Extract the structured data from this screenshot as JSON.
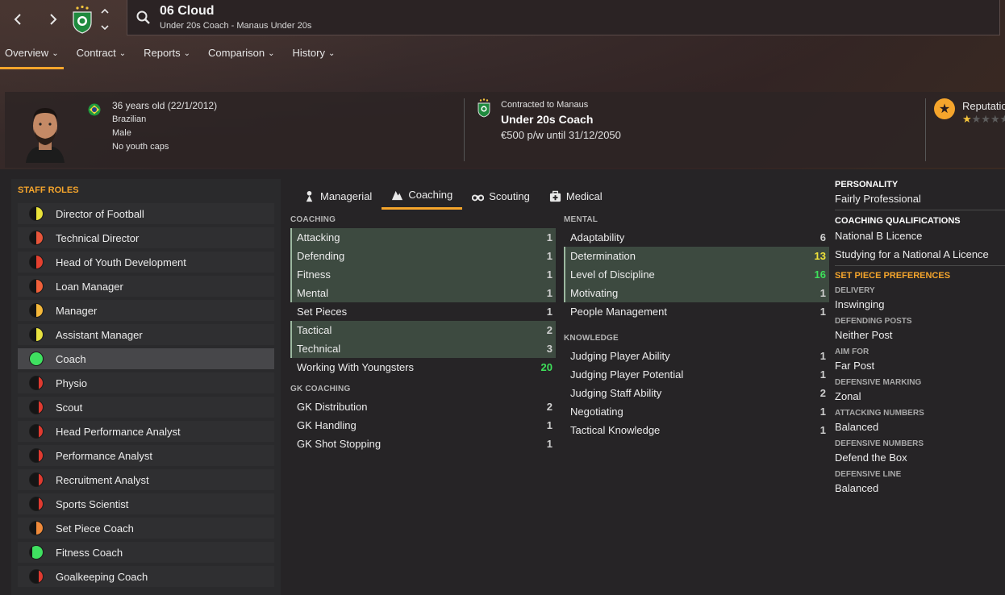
{
  "header": {
    "name": "06 Cloud",
    "subtitle": "Under 20s Coach - Manaus Under 20s"
  },
  "tabs": [
    {
      "label": "Overview"
    },
    {
      "label": "Contract"
    },
    {
      "label": "Reports"
    },
    {
      "label": "Comparison"
    },
    {
      "label": "History"
    }
  ],
  "profile": {
    "age": "36 years old (22/1/2012)",
    "nationality": "Brazilian",
    "gender": "Male",
    "youth_caps": "No youth caps",
    "contract_label": "Contracted to Manaus",
    "role": "Under 20s Coach",
    "wage": "€500 p/w until 31/12/2050",
    "reputation_label": "Reputation",
    "reputation_stars": 1
  },
  "staff_roles": {
    "title": "STAFF ROLES",
    "items": [
      {
        "label": "Director of Football",
        "color": "#e9e23a",
        "fill": 0.5
      },
      {
        "label": "Technical Director",
        "color": "#e8553a",
        "fill": 0.5
      },
      {
        "label": "Head of Youth Development",
        "color": "#e5402f",
        "fill": 0.5
      },
      {
        "label": "Loan Manager",
        "color": "#f0603a",
        "fill": 0.5
      },
      {
        "label": "Manager",
        "color": "#f5b83a",
        "fill": 0.5
      },
      {
        "label": "Assistant Manager",
        "color": "#e8e240",
        "fill": 0.5
      },
      {
        "label": "Coach",
        "color": "#3fe060",
        "fill": 1.0
      },
      {
        "label": "Physio",
        "color": "#e03a30",
        "fill": 0.3
      },
      {
        "label": "Scout",
        "color": "#e03a30",
        "fill": 0.3
      },
      {
        "label": "Head Performance Analyst",
        "color": "#e03a30",
        "fill": 0.3
      },
      {
        "label": "Performance Analyst",
        "color": "#e03a30",
        "fill": 0.3
      },
      {
        "label": "Recruitment Analyst",
        "color": "#e03a30",
        "fill": 0.3
      },
      {
        "label": "Sports Scientist",
        "color": "#e03a30",
        "fill": 0.3
      },
      {
        "label": "Set Piece Coach",
        "color": "#f08a3a",
        "fill": 0.5
      },
      {
        "label": "Fitness Coach",
        "color": "#3fe060",
        "fill": 0.8
      },
      {
        "label": "Goalkeeping Coach",
        "color": "#e03a30",
        "fill": 0.3
      }
    ],
    "active_index": 6
  },
  "attr_tabs": [
    {
      "label": "Managerial",
      "icon": "managerial-icon"
    },
    {
      "label": "Coaching",
      "icon": "coaching-icon"
    },
    {
      "label": "Scouting",
      "icon": "binoculars-icon"
    },
    {
      "label": "Medical",
      "icon": "medical-kit-icon"
    }
  ],
  "coaching": {
    "title": "COACHING",
    "rows": [
      {
        "label": "Attacking",
        "value": "1",
        "hl": true
      },
      {
        "label": "Defending",
        "value": "1",
        "hl": true
      },
      {
        "label": "Fitness",
        "value": "1",
        "hl": true
      },
      {
        "label": "Mental",
        "value": "1",
        "hl": true
      },
      {
        "label": "Set Pieces",
        "value": "1",
        "hl": false
      },
      {
        "label": "Tactical",
        "value": "2",
        "hl": true
      },
      {
        "label": "Technical",
        "value": "3",
        "hl": true
      },
      {
        "label": "Working With Youngsters",
        "value": "20",
        "hl": false,
        "color": "green"
      }
    ]
  },
  "gk_coaching": {
    "title": "GK COACHING",
    "rows": [
      {
        "label": "GK Distribution",
        "value": "2"
      },
      {
        "label": "GK Handling",
        "value": "1"
      },
      {
        "label": "GK Shot Stopping",
        "value": "1"
      }
    ]
  },
  "mental": {
    "title": "MENTAL",
    "rows": [
      {
        "label": "Adaptability",
        "value": "6",
        "hl": false
      },
      {
        "label": "Determination",
        "value": "13",
        "hl": true,
        "color": "yellow"
      },
      {
        "label": "Level of Discipline",
        "value": "16",
        "hl": true,
        "color": "green"
      },
      {
        "label": "Motivating",
        "value": "1",
        "hl": true
      },
      {
        "label": "People Management",
        "value": "1",
        "hl": false
      }
    ]
  },
  "knowledge": {
    "title": "KNOWLEDGE",
    "rows": [
      {
        "label": "Judging Player Ability",
        "value": "1"
      },
      {
        "label": "Judging Player Potential",
        "value": "1"
      },
      {
        "label": "Judging Staff Ability",
        "value": "2"
      },
      {
        "label": "Negotiating",
        "value": "1"
      },
      {
        "label": "Tactical Knowledge",
        "value": "1"
      }
    ]
  },
  "right": {
    "personality_title": "PERSONALITY",
    "personality": "Fairly Professional",
    "qual_title": "COACHING QUALIFICATIONS",
    "qual_1": "National B Licence",
    "qual_2": "Studying for a National A Licence",
    "setpiece_title": "SET PIECE PREFERENCES",
    "prefs": [
      {
        "label": "DELIVERY",
        "value": "Inswinging"
      },
      {
        "label": "DEFENDING POSTS",
        "value": "Neither Post"
      },
      {
        "label": "AIM FOR",
        "value": "Far Post"
      },
      {
        "label": "DEFENSIVE MARKING",
        "value": "Zonal"
      },
      {
        "label": "ATTACKING NUMBERS",
        "value": "Balanced"
      },
      {
        "label": "DEFENSIVE NUMBERS",
        "value": "Defend the Box"
      },
      {
        "label": "DEFENSIVE LINE",
        "value": "Balanced"
      }
    ]
  },
  "colors": {
    "accent": "#f5a52c",
    "highlight_row": "#3d4a40",
    "good": "#3ee05a",
    "medium": "#f0e33a"
  }
}
